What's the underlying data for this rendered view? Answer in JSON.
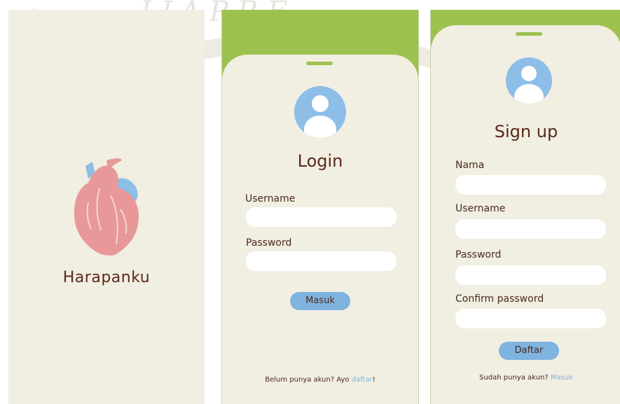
{
  "watermark": {
    "text": "I J A P R E"
  },
  "splash": {
    "app_name": "Harapanku",
    "logo_icon": "anatomical-heart-icon"
  },
  "login": {
    "avatar_icon": "user-avatar-icon",
    "title": "Login",
    "username_label": "Username",
    "password_label": "Password",
    "submit_label": "Masuk",
    "footer_text": "Belum punya akun? Ayo ",
    "footer_link": "daftar",
    "footer_suffix": "!"
  },
  "signup": {
    "avatar_icon": "user-avatar-icon",
    "title": "Sign up",
    "name_label": "Nama",
    "username_label": "Username",
    "password_label": "Password",
    "confirm_label": "Confirm password",
    "submit_label": "Daftar",
    "footer_text": "Sudah punya akun? ",
    "footer_link": "Masuk"
  },
  "colors": {
    "background": "#f1eee2",
    "green": "#9dc14e",
    "blue": "#7fb3e0",
    "text_brown": "#5a2a18",
    "heart_pink": "#e89898"
  }
}
